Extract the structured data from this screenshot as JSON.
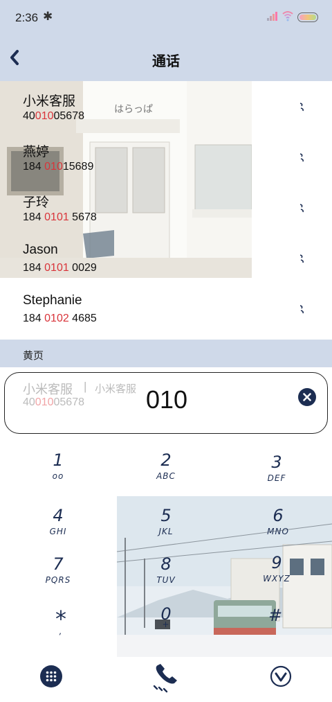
{
  "status": {
    "time": "2:36"
  },
  "header": {
    "title": "通话"
  },
  "contacts": [
    {
      "name": "小米客服",
      "num_pre": "40",
      "num_hl": "010",
      "num_post": "05678"
    },
    {
      "name": "燕婷",
      "num_pre": "184 ",
      "num_hl": "010",
      "num_post": "15689"
    },
    {
      "name": "子玲",
      "num_pre": "184 ",
      "num_hl": "0101",
      "num_post": " 5678"
    },
    {
      "name": "Jason",
      "num_pre": "184 ",
      "num_hl": "0101",
      "num_post": " 0029"
    },
    {
      "name": "Stephanie",
      "num_pre": "184 ",
      "num_hl": "0102",
      "num_post": " 4685"
    }
  ],
  "section": {
    "label": "黄页"
  },
  "search": {
    "value": "010",
    "suggestion_name": "小米客服",
    "suggestion_sep": "|",
    "suggestion_alt": "小米客服",
    "suggestion_num_pre": "40",
    "suggestion_num_hl": "010",
    "suggestion_num_post": "05678"
  },
  "keypad": [
    {
      "digit": "1",
      "letters": "oo"
    },
    {
      "digit": "2",
      "letters": "ABC"
    },
    {
      "digit": "3",
      "letters": "DEF"
    },
    {
      "digit": "4",
      "letters": "GHI"
    },
    {
      "digit": "5",
      "letters": "JKL"
    },
    {
      "digit": "6",
      "letters": "MNO"
    },
    {
      "digit": "7",
      "letters": "PQRS"
    },
    {
      "digit": "8",
      "letters": "TUV"
    },
    {
      "digit": "9",
      "letters": "WXYZ"
    },
    {
      "digit": "*",
      "letters": ","
    },
    {
      "digit": "0",
      "letters": "+"
    },
    {
      "digit": "#",
      "letters": ""
    }
  ],
  "colors": {
    "header_bg": "#cfd9e9",
    "accent": "#1c2d52",
    "highlight": "#d9343a"
  },
  "icons": {
    "back": "chevron-left-icon",
    "clear": "clear-icon",
    "keyboard": "keypad-icon",
    "dial": "phone-call-icon",
    "hide": "collapse-icon"
  }
}
